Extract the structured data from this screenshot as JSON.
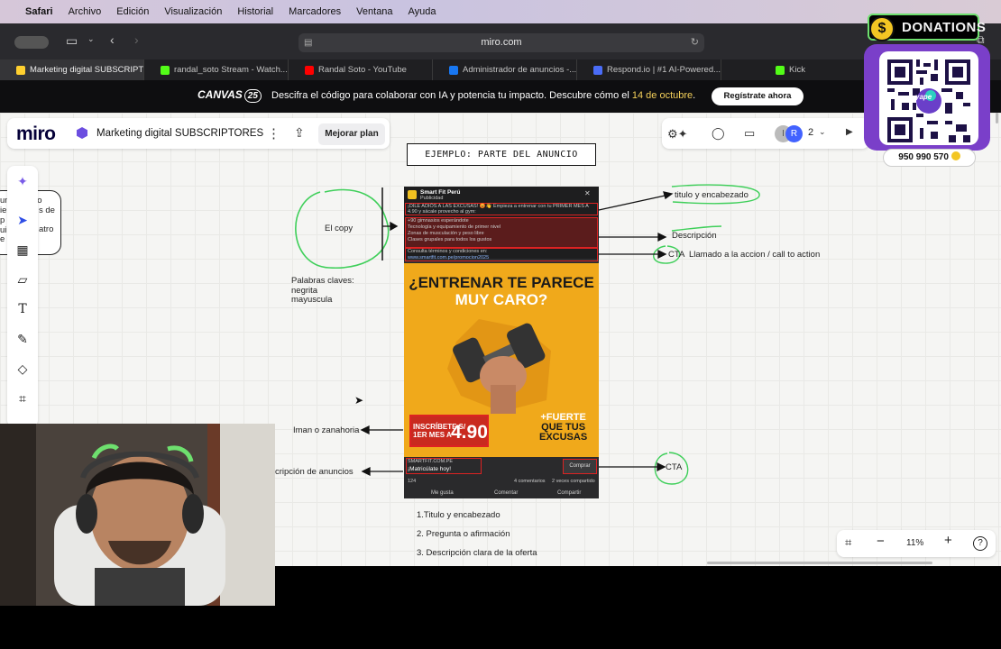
{
  "menubar": {
    "items": [
      "Safari",
      "Archivo",
      "Edición",
      "Visualización",
      "Historial",
      "Marcadores",
      "Ventana",
      "Ayuda"
    ]
  },
  "browser": {
    "url": "miro.com",
    "tabs": [
      {
        "label": "Marketing digital SUBSCRIPT...",
        "icon": "miro-icon",
        "color": "#ffd02f",
        "active": true
      },
      {
        "label": "randal_soto Stream - Watch...",
        "icon": "kick-icon",
        "color": "#53fc18",
        "active": false
      },
      {
        "label": "Randal Soto - YouTube",
        "icon": "youtube-icon",
        "color": "#ff0000",
        "active": false
      },
      {
        "label": "Administrador de anuncios -...",
        "icon": "meta-icon",
        "color": "#1877f2",
        "active": false
      },
      {
        "label": "Respond.io | #1 AI-Powered...",
        "icon": "respond-icon",
        "color": "#4a6cf7",
        "active": false
      },
      {
        "label": "Kick",
        "icon": "kick-icon",
        "color": "#53fc18",
        "active": false
      }
    ]
  },
  "banner": {
    "logo": "CANVAS",
    "logo_num": "25",
    "text": "Descifra el código para colaborar con IA y potencia tu impacto. Descubre cómo el ",
    "date": "14 de octubre",
    "text_end": ".",
    "cta": "Regístrate ahora"
  },
  "miro": {
    "logo": "miro",
    "board_title": "Marketing digital SUBSCRIPTORES",
    "upgrade": "Mejorar plan",
    "user_count": "2",
    "avatar_initial": "R",
    "zoom": "11%"
  },
  "board": {
    "example_title": "EJEMPLO: PARTE DEL ANUNCIO",
    "el_copy": "El copy",
    "keywords": [
      "Palabras claves:",
      "negrita",
      "mayuscula"
    ],
    "titulo": "titulo y encabezado",
    "descripcion": "Descripción",
    "cta_top": "CTA",
    "cta_top_desc": "Llamado a la accion / call to action",
    "iman": "Iman o zanahoria",
    "desc_anuncios": "cripción  de anuncios",
    "cta_bottom": "CTA",
    "list": [
      "1.Titulo y encabezado",
      "2. Pregunta o afirmación",
      "3. Descripción clara de la oferta"
    ],
    "left_fragment": [
      "un anuncio",
      "ie",
      "s de",
      "p",
      "ui",
      "atro",
      "e"
    ]
  },
  "ad": {
    "page_name": "Smart Fit Perú",
    "sponsored": "Publicidad",
    "copy_lines": [
      "¡DILE ADIÓS A LAS EXCUSAS! 😡👋  Empieza a entrenar con tu PRIMER MES A",
      "4.90  y sácale provecho al gym:",
      "+90 gimnasios esperándote",
      "Tecnología y equipamiento de primer nivel",
      "Zonas de musculación y peso libre",
      "Clases grupales para todos los gustos",
      "Consulta términos y condiciones en:",
      "www.smartfit.com.pe/promocion2025"
    ],
    "headline_1": "¿ENTRENAR TE PARECE",
    "headline_2": "MUY CARO?",
    "price_label_1": "INSCRÍBETE S/",
    "price_label_2": "1ER MES A",
    "price": "4.90",
    "fuerte_1": "+FUERTE",
    "fuerte_2": "QUE TUS",
    "fuerte_3": "EXCUSAS",
    "domain": "SMARTFIT.COM.PE",
    "cta_text": "¡Matricúlate hoy!",
    "button": "Comprar",
    "reactions": "124",
    "comments": "4 comentarios",
    "shares": "2 veces compartido",
    "actions": [
      "Me gusta",
      "Comentar",
      "Compartir"
    ]
  },
  "overlay": {
    "donations": "DONATIONS",
    "dollar": "$",
    "qr_brand": "yape",
    "phone": "950 990 570"
  },
  "colors": {
    "accent_green": "#3fcf5a",
    "ad_yellow": "#f0a91b",
    "miro_blue": "#4262ff"
  }
}
